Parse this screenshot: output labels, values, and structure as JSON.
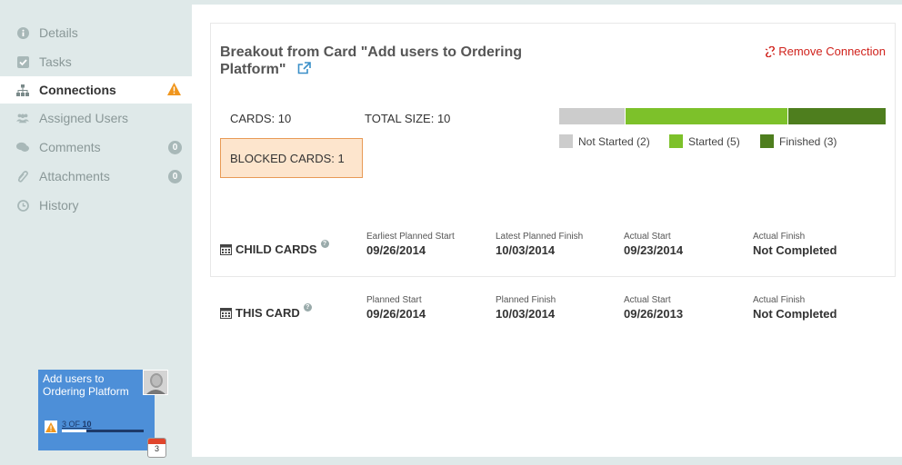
{
  "sidebar": {
    "items": [
      {
        "label": "Details",
        "icon": "info-icon"
      },
      {
        "label": "Tasks",
        "icon": "checkbox-icon"
      },
      {
        "label": "Connections",
        "icon": "hierarchy-icon",
        "active": true
      },
      {
        "label": "Assigned Users",
        "icon": "users-icon"
      },
      {
        "label": "Comments",
        "icon": "comment-icon",
        "count": "0"
      },
      {
        "label": "Attachments",
        "icon": "paperclip-icon",
        "count": "0"
      },
      {
        "label": "History",
        "icon": "clock-icon"
      }
    ]
  },
  "mini_card": {
    "title": "Add users to Ordering Platform",
    "progress_current": "3",
    "progress_of": "OF",
    "progress_total": "10",
    "progress_fraction": 0.3,
    "calendar_day": "3",
    "color": "#4d8fd8"
  },
  "panel": {
    "title": "Breakout from Card \"Add users to Ordering Platform\"",
    "remove_label": "Remove Connection",
    "cards_label": "CARDS: 10",
    "total_size_label": "TOTAL SIZE: 10",
    "blocked_label": "BLOCKED CARDS: 1",
    "progress": [
      {
        "label": "Not Started (2)",
        "count": 2,
        "color": "#cccccc"
      },
      {
        "label": "Started (5)",
        "count": 5,
        "color": "#7dc12a"
      },
      {
        "label": "Finished (3)",
        "count": 3,
        "color": "#4e7e1e"
      }
    ],
    "child_cards": {
      "label": "CHILD CARDS",
      "columns": [
        {
          "label": "Earliest Planned Start",
          "value": "09/26/2014"
        },
        {
          "label": "Latest Planned Finish",
          "value": "10/03/2014"
        },
        {
          "label": "Actual Start",
          "value": "09/23/2014"
        },
        {
          "label": "Actual Finish",
          "value": "Not Completed"
        }
      ]
    },
    "this_card": {
      "label": "THIS CARD",
      "columns": [
        {
          "label": "Planned Start",
          "value": "09/26/2014"
        },
        {
          "label": "Planned Finish",
          "value": "10/03/2014"
        },
        {
          "label": "Actual Start",
          "value": "09/26/2013"
        },
        {
          "label": "Actual Finish",
          "value": "Not Completed"
        }
      ]
    }
  }
}
